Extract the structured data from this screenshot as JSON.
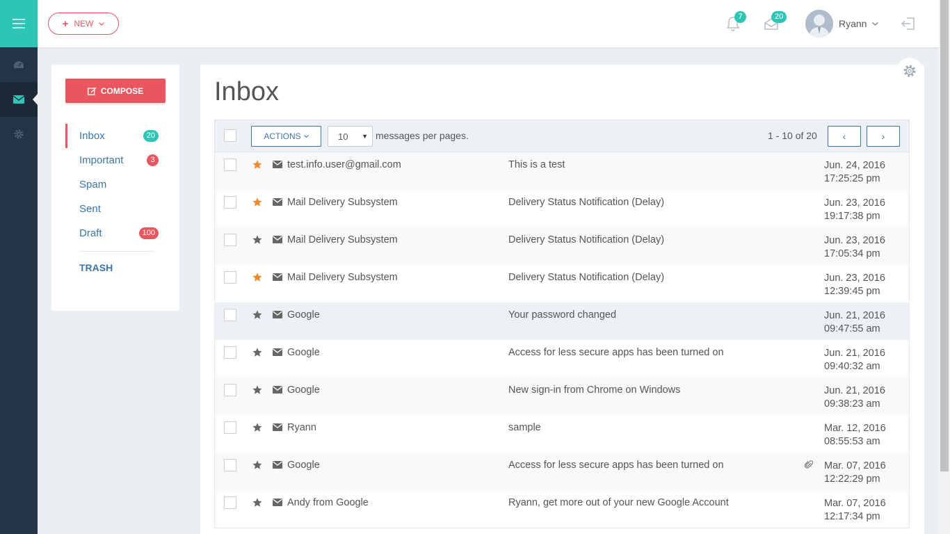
{
  "topbar": {
    "new_label": "NEW",
    "notifications_count": "7",
    "messages_count": "20",
    "user_name": "Ryann"
  },
  "folders": {
    "compose_label": "COMPOSE",
    "items": [
      {
        "label": "Inbox",
        "count": "20",
        "badge": "teal"
      },
      {
        "label": "Important",
        "count": "3",
        "badge": "red"
      },
      {
        "label": "Spam",
        "count": ""
      },
      {
        "label": "Sent",
        "count": ""
      },
      {
        "label": "Draft",
        "count": "100",
        "badge": "red"
      }
    ],
    "trash_label": "TRASH"
  },
  "inbox": {
    "title": "Inbox",
    "actions_label": "ACTIONS",
    "per_page_value": "10",
    "per_page_label": "messages per pages.",
    "pager_text": "1 - 10 of 20",
    "prev_label": "‹",
    "next_label": "›"
  },
  "messages": [
    {
      "starred": true,
      "sender": "test.info.user@gmail.com",
      "subject": "This is a test",
      "date": "Jun. 24, 2016",
      "time": "17:25:25 pm",
      "attachment": false
    },
    {
      "starred": true,
      "sender": "Mail Delivery Subsystem",
      "subject": "Delivery Status Notification (Delay)",
      "date": "Jun. 23, 2016",
      "time": "19:17:38 pm",
      "attachment": false
    },
    {
      "starred": false,
      "sender": "Mail Delivery Subsystem",
      "subject": "Delivery Status Notification (Delay)",
      "date": "Jun. 23, 2016",
      "time": "17:05:34 pm",
      "attachment": false
    },
    {
      "starred": true,
      "sender": "Mail Delivery Subsystem",
      "subject": "Delivery Status Notification (Delay)",
      "date": "Jun. 23, 2016",
      "time": "12:39:45 pm",
      "attachment": false
    },
    {
      "starred": false,
      "sender": "Google",
      "subject": "Your password changed",
      "date": "Jun. 21, 2016",
      "time": "09:47:55 am",
      "attachment": false,
      "highlighted": true
    },
    {
      "starred": false,
      "sender": "Google",
      "subject": "Access for less secure apps has been turned on",
      "date": "Jun. 21, 2016",
      "time": "09:40:32 am",
      "attachment": false
    },
    {
      "starred": false,
      "sender": "Google",
      "subject": "New sign-in from Chrome on Windows",
      "date": "Jun. 21, 2016",
      "time": "09:38:23 am",
      "attachment": false
    },
    {
      "starred": false,
      "sender": "Ryann",
      "subject": "sample",
      "date": "Mar. 12, 2016",
      "time": "08:55:53 am",
      "attachment": false
    },
    {
      "starred": false,
      "sender": "Google",
      "subject": "Access for less secure apps has been turned on",
      "date": "Mar. 07, 2016",
      "time": "12:22:29 pm",
      "attachment": true
    },
    {
      "starred": false,
      "sender": "Andy from Google",
      "subject": "Ryann, get more out of your new Google Account",
      "date": "Mar. 07, 2016",
      "time": "12:17:34 pm",
      "attachment": false
    }
  ],
  "colors": {
    "accent_teal": "#2ec4b6",
    "accent_red": "#e8575f",
    "link_blue": "#3b76a8",
    "star_on": "#f0892c",
    "star_off": "#666666",
    "sidebar_dark": "#243447"
  },
  "icons": [
    "menu-icon",
    "dashboard-icon",
    "mail-icon",
    "settings-icon",
    "bell-icon",
    "envelope-icon",
    "logout-icon",
    "gear-icon",
    "star-icon",
    "paperclip-icon",
    "chevron-down-icon"
  ]
}
